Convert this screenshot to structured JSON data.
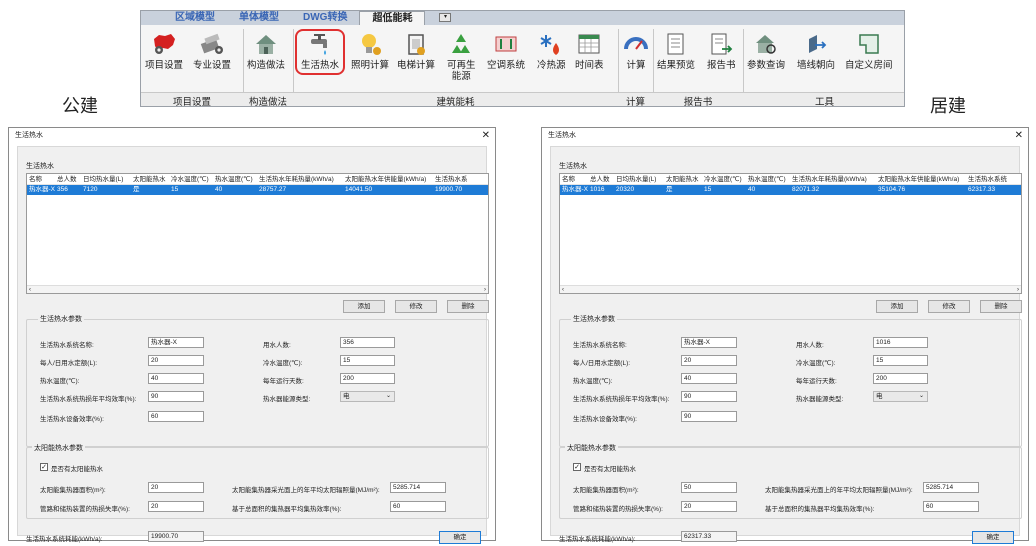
{
  "ribbon": {
    "tabs": [
      "区域模型",
      "单体模型",
      "DWG转换",
      "超低能耗"
    ],
    "active_tab": "超低能耗",
    "buttons": {
      "project_settings": "项目设置",
      "discipline_settings": "专业设置",
      "construction": "构造做法",
      "domestic_hot_water": "生活热水",
      "lighting_calc": "照明计算",
      "elevator_calc": "电梯计算",
      "renewable_1": "可再生",
      "renewable_2": "能源",
      "ac_system": "空调系统",
      "cold_heat_source": "冷热源",
      "schedule": "时间表",
      "calculate": "计算",
      "result_preview": "结果预览",
      "report": "报告书",
      "param_query": "参数查询",
      "wall_orientation": "墙线朝向",
      "custom_room": "自定义房间"
    },
    "groups": [
      "项目设置",
      "构造做法",
      "建筑能耗",
      "计算",
      "报告书",
      "工具"
    ]
  },
  "labels": {
    "public": "公建",
    "residential": "居建"
  },
  "dialogs": [
    {
      "title": "生活热水",
      "section_list": "生活热水",
      "columns": [
        "名称",
        "总人数",
        "日均热水量(L)",
        "太阳能热水",
        "冷水温度(℃)",
        "热水温度(℃)",
        "生活热水年耗热量(kWh/a)",
        "太阳能热水年供能量(kWh/a)",
        "生活热水系"
      ],
      "row": [
        "热水器-X",
        "356",
        "7120",
        "是",
        "15",
        "40",
        "28757.27",
        "14041.50",
        "19900.70"
      ],
      "buttons": {
        "add": "添加",
        "modify": "修改",
        "delete": "删除",
        "ok": "确定"
      },
      "params_title": "生活热水参数",
      "fields": {
        "system_name_label": "生活热水系统名称:",
        "system_name": "热水器-X",
        "users_label": "用水人数:",
        "users": "356",
        "daily_water_label": "每人/日用水定额(L):",
        "daily_water": "20",
        "cold_temp_label": "冷水温度(℃):",
        "cold_temp": "15",
        "hot_temp_label": "热水温度(℃):",
        "hot_temp": "40",
        "run_days_label": "每年运行天数:",
        "run_days": "200",
        "pipe_eff_label": "生活热水系统热损年平均效率(%):",
        "pipe_eff": "90",
        "energy_type_label": "热水器能源类型:",
        "energy_type": "电",
        "heater_eff_label": "生活热水设备效率(%):",
        "heater_eff": "60"
      },
      "solar_title": "太阳能热水参数",
      "solar_check_label": "是否有太阳能热水",
      "solar": {
        "area_label": "太阳能集热器面积(m²):",
        "area": "20",
        "radiation_label": "太阳能集热器采光面上的年平均太阳辐照量(MJ/m²):",
        "radiation": "5285.714",
        "loss_label": "管路和储热装置的热损失率(%):",
        "loss": "20",
        "collector_eff_label": "基于总面积的集热器平均集热效率(%):",
        "collector_eff": "60"
      },
      "footer_label": "生活热水系统耗能(kWh/a):",
      "footer_value": "19900.70"
    },
    {
      "title": "生活热水",
      "section_list": "生活热水",
      "columns": [
        "名称",
        "总人数",
        "日均热水量(L)",
        "太阳能热水",
        "冷水温度(℃)",
        "热水温度(℃)",
        "生活热水年耗热量(kWh/a)",
        "太阳能热水年供能量(kWh/a)",
        "生活热水系统"
      ],
      "row": [
        "热水器-X",
        "1016",
        "20320",
        "是",
        "15",
        "40",
        "82071.32",
        "35104.76",
        "62317.33"
      ],
      "buttons": {
        "add": "添加",
        "modify": "修改",
        "delete": "删除",
        "ok": "确定"
      },
      "params_title": "生活热水参数",
      "fields": {
        "system_name_label": "生活热水系统名称:",
        "system_name": "热水器-X",
        "users_label": "用水人数:",
        "users": "1016",
        "daily_water_label": "每人/日用水定额(L):",
        "daily_water": "20",
        "cold_temp_label": "冷水温度(℃):",
        "cold_temp": "15",
        "hot_temp_label": "热水温度(℃):",
        "hot_temp": "40",
        "run_days_label": "每年运行天数:",
        "run_days": "200",
        "pipe_eff_label": "生活热水系统热损年平均效率(%):",
        "pipe_eff": "90",
        "energy_type_label": "热水器能源类型:",
        "energy_type": "电",
        "heater_eff_label": "生活热水设备效率(%):",
        "heater_eff": "90"
      },
      "solar_title": "太阳能热水参数",
      "solar_check_label": "是否有太阳能热水",
      "solar": {
        "area_label": "太阳能集热器面积(m²):",
        "area": "50",
        "radiation_label": "太阳能集热器采光面上的年平均太阳辐照量(MJ/m²):",
        "radiation": "5285.714",
        "loss_label": "管路和储热装置的热损失率(%):",
        "loss": "20",
        "collector_eff_label": "基于总面积的集热器平均集热效率(%):",
        "collector_eff": "60"
      },
      "footer_label": "生活热水系统耗能(kWh/a):",
      "footer_value": "62317.33"
    }
  ]
}
